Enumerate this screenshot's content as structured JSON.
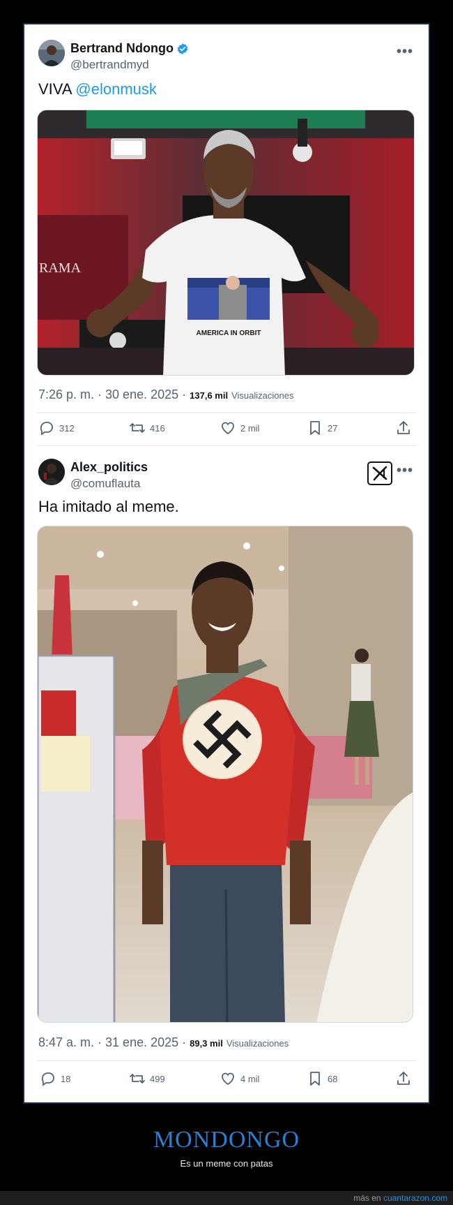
{
  "tweet1": {
    "name": "Bertrand Ndongo",
    "handle": "@bertrandmyd",
    "text_prefix": "VIVA ",
    "mention": "@elonmusk",
    "image": {
      "banner_text": "RAMA",
      "shirt_text": "AMERICA IN ORBIT"
    },
    "time": "7:26 p. m. · 30 ene. 2025",
    "views_sep": " · ",
    "views_count": "137,6 mil",
    "views_label": "Visualizaciones",
    "replies": "312",
    "retweets": "416",
    "likes": "2 mil",
    "bookmarks": "27"
  },
  "tweet2": {
    "name": "Alex_politics",
    "handle": "@comuflauta",
    "text": "Ha imitado al meme.",
    "time": "8:47 a. m. · 31 ene. 2025",
    "views_sep": " · ",
    "views_count": "89,3 mil",
    "views_label": "Visualizaciones",
    "replies": "18",
    "retweets": "499",
    "likes": "4 mil",
    "bookmarks": "68"
  },
  "icons": {
    "more": "more-icon",
    "reply": "reply-icon",
    "retweet": "retweet-icon",
    "like": "heart-icon",
    "bookmark": "bookmark-icon",
    "share": "share-icon",
    "verified": "verified-badge-icon",
    "grok": "grok-icon"
  },
  "footer": {
    "title": "MONDONGO",
    "subtitle": "Es un meme con patas",
    "more_prefix": "más en ",
    "site": "cuantarazon.com"
  },
  "colors": {
    "accent": "#1d9bf0",
    "footer_title": "#2a7fd0",
    "panel_border": "#1d2b4f"
  }
}
